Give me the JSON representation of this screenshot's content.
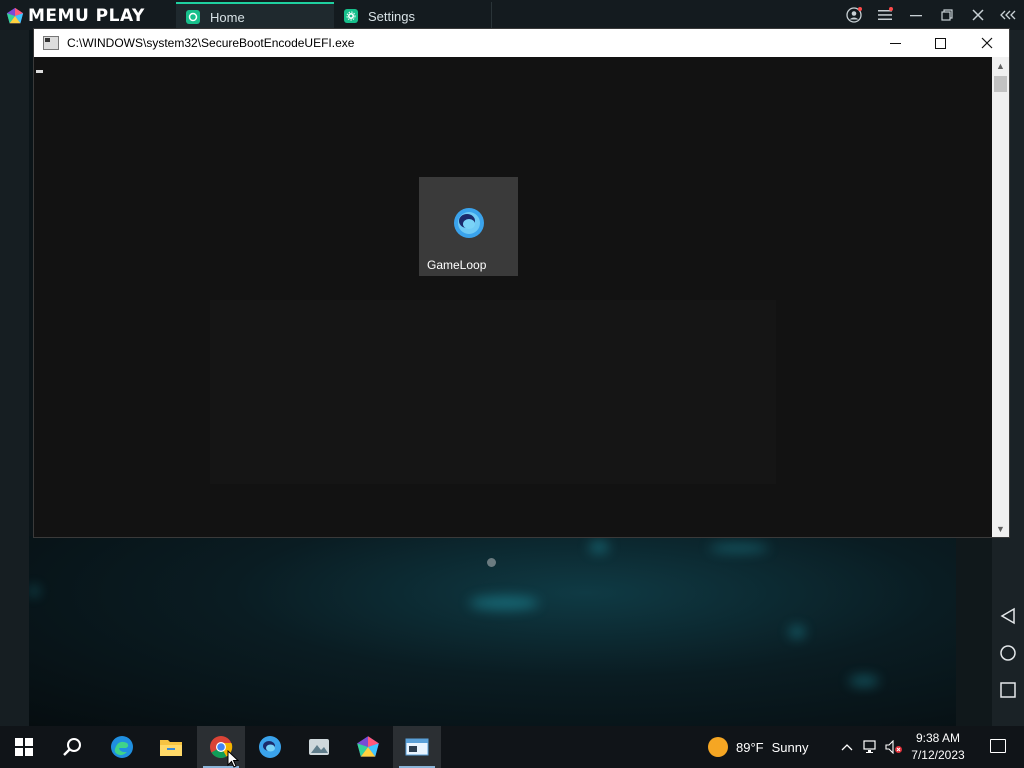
{
  "memu": {
    "brand": "MEMU PLAY",
    "tabs": [
      {
        "label": "Home"
      },
      {
        "label": "Settings"
      }
    ]
  },
  "console": {
    "title": "C:\\WINDOWS\\system32\\SecureBootEncodeUEFI.exe",
    "content": "-"
  },
  "desktop_app": {
    "label": "GameLoop"
  },
  "taskbar": {
    "pinned": [
      "start-icon",
      "search-icon",
      "edge-icon",
      "file-explorer-icon",
      "chrome-icon",
      "gameloop-icon",
      "photos-icon",
      "memu-icon",
      "console-app-icon"
    ],
    "weather": {
      "temp": "89°F",
      "condition": "Sunny"
    },
    "clock": {
      "time": "9:38 AM",
      "date": "7/12/2023"
    }
  },
  "colors": {
    "memu_accent": "#1fd0a0",
    "console_bg": "#0c0c0c",
    "taskbar_bg": "#101418"
  }
}
